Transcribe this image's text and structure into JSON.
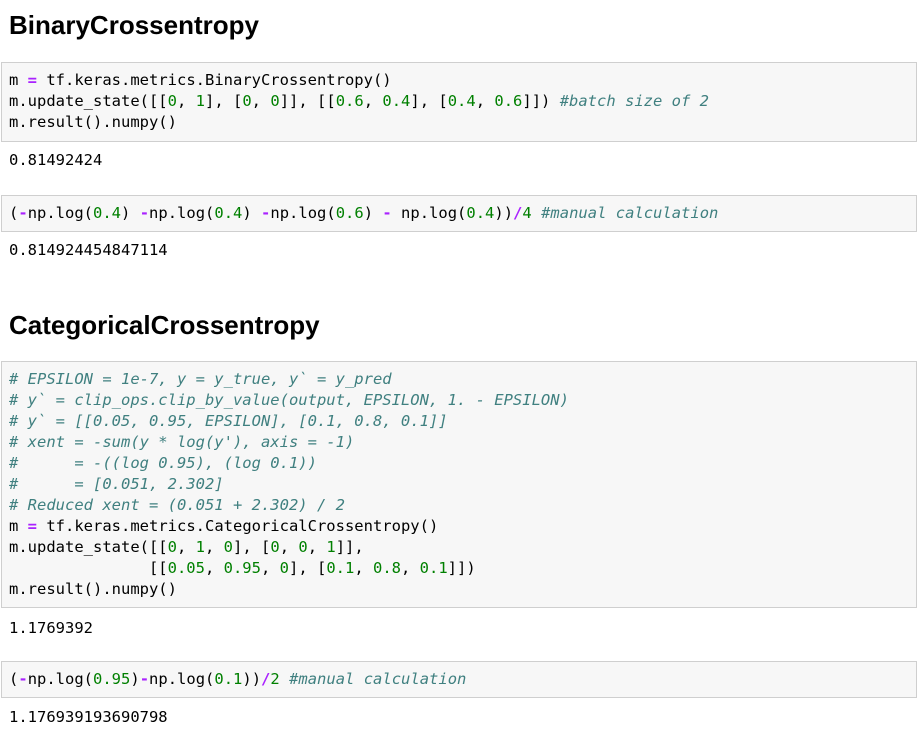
{
  "sections": [
    {
      "heading": "BinaryCrossentropy",
      "cells": [
        {
          "lines": [
            [
              [
                "m ",
                "pu"
              ],
              [
                "=",
                "op"
              ],
              [
                " tf.keras.metrics.BinaryCrossentropy()",
                "pu"
              ]
            ],
            [
              [
                "m.update_state([[",
                "pu"
              ],
              [
                "0",
                "num"
              ],
              [
                ", ",
                "pu"
              ],
              [
                "1",
                "num"
              ],
              [
                "], [",
                "pu"
              ],
              [
                "0",
                "num"
              ],
              [
                ", ",
                "pu"
              ],
              [
                "0",
                "num"
              ],
              [
                "]], [[",
                "pu"
              ],
              [
                "0.6",
                "num"
              ],
              [
                ", ",
                "pu"
              ],
              [
                "0.4",
                "num"
              ],
              [
                "], [",
                "pu"
              ],
              [
                "0.4",
                "num"
              ],
              [
                ", ",
                "pu"
              ],
              [
                "0.6",
                "num"
              ],
              [
                "]]) ",
                "pu"
              ],
              [
                "#batch size of 2",
                "cm"
              ]
            ],
            [
              [
                "m.result().numpy()",
                "pu"
              ]
            ]
          ],
          "output": "0.81492424"
        },
        {
          "lines": [
            [
              [
                "(",
                "pu"
              ],
              [
                "-",
                "op"
              ],
              [
                "np.log(",
                "pu"
              ],
              [
                "0.4",
                "num"
              ],
              [
                ") ",
                "pu"
              ],
              [
                "-",
                "op"
              ],
              [
                "np.log(",
                "pu"
              ],
              [
                "0.4",
                "num"
              ],
              [
                ") ",
                "pu"
              ],
              [
                "-",
                "op"
              ],
              [
                "np.log(",
                "pu"
              ],
              [
                "0.6",
                "num"
              ],
              [
                ") ",
                "pu"
              ],
              [
                "-",
                "op"
              ],
              [
                " np.log(",
                "pu"
              ],
              [
                "0.4",
                "num"
              ],
              [
                "))",
                "pu"
              ],
              [
                "/",
                "op"
              ],
              [
                "4",
                "num"
              ],
              [
                " ",
                "pu"
              ],
              [
                "#manual calculation",
                "cm"
              ]
            ]
          ],
          "output": "0.814924454847114"
        }
      ]
    },
    {
      "heading": "CategoricalCrossentropy",
      "cells": [
        {
          "lines": [
            [
              [
                "# EPSILON = 1e-7, y = y_true, y` = y_pred",
                "cm"
              ]
            ],
            [
              [
                "# y` = clip_ops.clip_by_value(output, EPSILON, 1. - EPSILON)",
                "cm"
              ]
            ],
            [
              [
                "# y` = [[0.05, 0.95, EPSILON], [0.1, 0.8, 0.1]]",
                "cm"
              ]
            ],
            [
              [
                "# xent = -sum(y * log(y'), axis = -1)",
                "cm"
              ]
            ],
            [
              [
                "#      = -((log 0.95), (log 0.1))",
                "cm"
              ]
            ],
            [
              [
                "#      = [0.051, 2.302]",
                "cm"
              ]
            ],
            [
              [
                "# Reduced xent = (0.051 + 2.302) / 2",
                "cm"
              ]
            ],
            [
              [
                "m ",
                "pu"
              ],
              [
                "=",
                "op"
              ],
              [
                " tf.keras.metrics.CategoricalCrossentropy()",
                "pu"
              ]
            ],
            [
              [
                "m.update_state([[",
                "pu"
              ],
              [
                "0",
                "num"
              ],
              [
                ", ",
                "pu"
              ],
              [
                "1",
                "num"
              ],
              [
                ", ",
                "pu"
              ],
              [
                "0",
                "num"
              ],
              [
                "], [",
                "pu"
              ],
              [
                "0",
                "num"
              ],
              [
                ", ",
                "pu"
              ],
              [
                "0",
                "num"
              ],
              [
                ", ",
                "pu"
              ],
              [
                "1",
                "num"
              ],
              [
                "]],",
                "pu"
              ]
            ],
            [
              [
                "               [[",
                "pu"
              ],
              [
                "0.05",
                "num"
              ],
              [
                ", ",
                "pu"
              ],
              [
                "0.95",
                "num"
              ],
              [
                ", ",
                "pu"
              ],
              [
                "0",
                "num"
              ],
              [
                "], [",
                "pu"
              ],
              [
                "0.1",
                "num"
              ],
              [
                ", ",
                "pu"
              ],
              [
                "0.8",
                "num"
              ],
              [
                ", ",
                "pu"
              ],
              [
                "0.1",
                "num"
              ],
              [
                "]])",
                "pu"
              ]
            ],
            [
              [
                "m.result().numpy()",
                "pu"
              ]
            ]
          ],
          "output": "1.1769392"
        },
        {
          "lines": [
            [
              [
                "(",
                "pu"
              ],
              [
                "-",
                "op"
              ],
              [
                "np.log(",
                "pu"
              ],
              [
                "0.95",
                "num"
              ],
              [
                ")",
                "pu"
              ],
              [
                "-",
                "op"
              ],
              [
                "np.log(",
                "pu"
              ],
              [
                "0.1",
                "num"
              ],
              [
                "))",
                "pu"
              ],
              [
                "/",
                "op"
              ],
              [
                "2",
                "num"
              ],
              [
                " ",
                "pu"
              ],
              [
                "#manual calculation",
                "cm"
              ]
            ]
          ],
          "output": "1.176939193690798"
        }
      ]
    }
  ]
}
